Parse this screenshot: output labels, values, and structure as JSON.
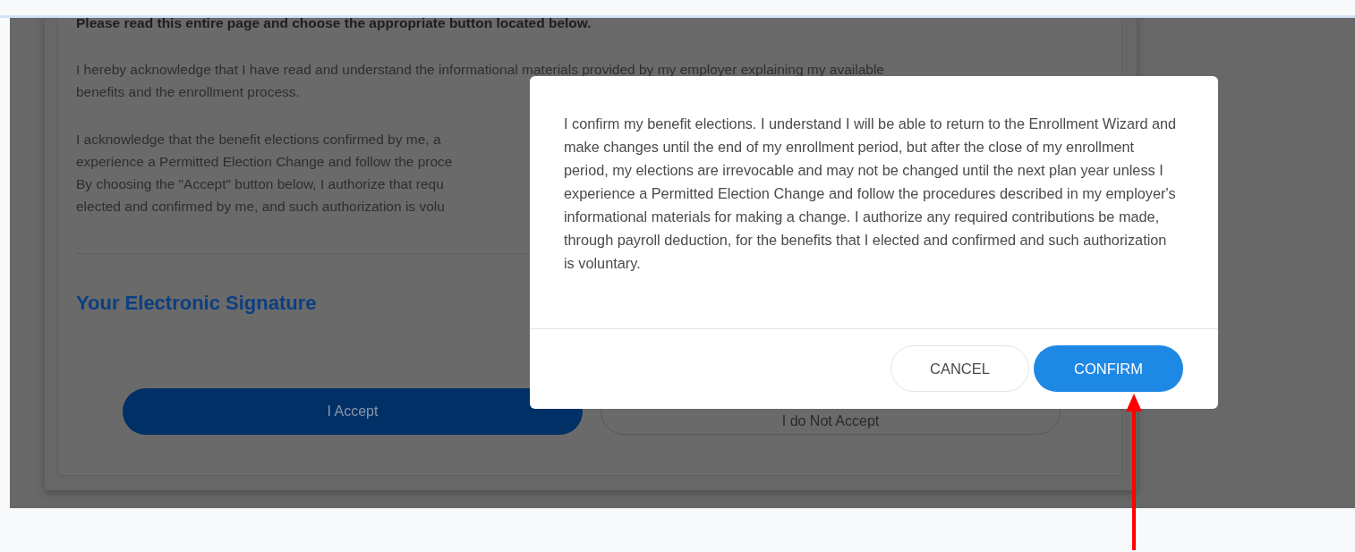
{
  "consent_card": {
    "instruction": "Please read this entire page and choose the appropriate button located below.",
    "paragraphs": [
      [
        "I hereby acknowledge that I have read and understand the informational materials provided by my employer explaining my available",
        "benefits and the enrollment process."
      ],
      [
        "I acknowledge that the benefit elections confirmed by me, a",
        "experience a Permitted Election Change and follow the proce",
        "By choosing the \"Accept\" button below, I authorize that requ",
        "elected and confirmed by me, and such authorization is volu"
      ]
    ],
    "signature_heading": "Your Electronic Signature",
    "buttons": [
      {
        "label": "I Accept",
        "kind": "primary"
      },
      {
        "label": "I do Not Accept",
        "kind": "outline"
      }
    ]
  },
  "dialog": {
    "message": "I confirm my benefit elections. I understand I will be able to return to the Enrollment Wizard and make changes until the end of my enrollment period, but after the close of my enrollment period, my elections are irrevocable and may not be changed until the next plan year unless I experience a Permitted Election Change and follow the procedures described in my employer's informational materials for making a change. I authorize any required contributions be made, through payroll deduction, for the benefits that I elected and confirmed and such authorization is voluntary.",
    "buttons": [
      {
        "label": "CANCEL",
        "kind": "outline"
      },
      {
        "label": "CONFIRM",
        "kind": "primary"
      }
    ]
  }
}
